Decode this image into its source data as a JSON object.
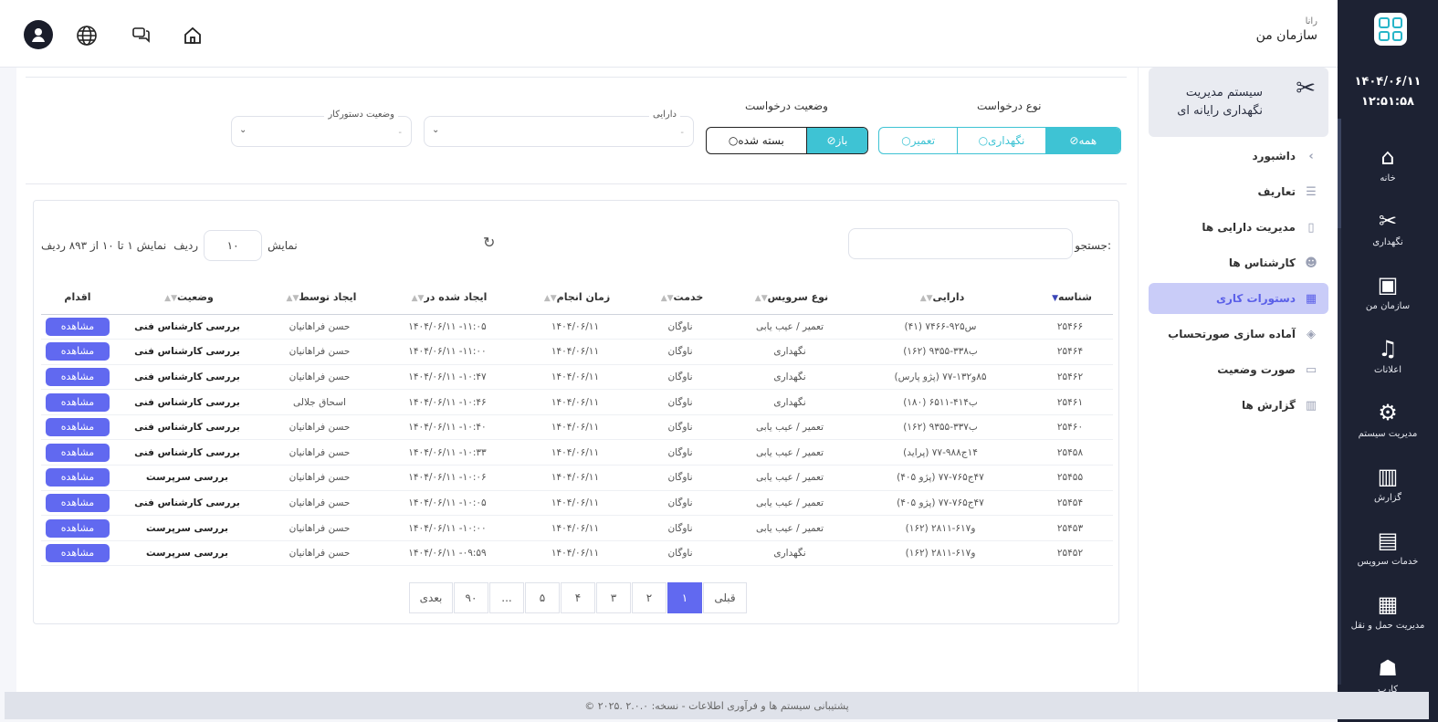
{
  "rail": {
    "date": "۱۴۰۴/۰۶/۱۱",
    "time": "۱۲:۵۱:۵۸",
    "items": [
      {
        "label": "خانه",
        "icon": "home-icon"
      },
      {
        "label": "نگهداری",
        "icon": "tools-icon"
      },
      {
        "label": "سازمان من",
        "icon": "organization-icon"
      },
      {
        "label": "اعلانات",
        "icon": "bell-icon"
      },
      {
        "label": "مدیریت سیستم",
        "icon": "gears-icon"
      },
      {
        "label": "گزارش",
        "icon": "report-chart-icon"
      },
      {
        "label": "خدمات سرویس",
        "icon": "bus-icon"
      },
      {
        "label": "مدیریت حمل و نقل",
        "icon": "car-icon"
      },
      {
        "label": "کارب",
        "icon": "users-icon"
      }
    ]
  },
  "header": {
    "org_small": "رانا",
    "org_name": "سازمان من"
  },
  "sidebar": {
    "system_title": "سیستم مدیریت نگهداری رایانه ای",
    "items": [
      {
        "label": "داشبورد",
        "icon": "chevron-left-icon"
      },
      {
        "label": "تعاریف",
        "icon": "definitions-icon"
      },
      {
        "label": "مدیریت دارایی ها",
        "icon": "asset-icon"
      },
      {
        "label": "کارشناس ها",
        "icon": "experts-icon"
      },
      {
        "label": "دستورات کاری",
        "icon": "work-orders-icon"
      },
      {
        "label": "آماده سازی صورتحساب",
        "icon": "layers-icon"
      },
      {
        "label": "صورت وضعیت",
        "icon": "briefcase-icon"
      },
      {
        "label": "گزارش ها",
        "icon": "bar-chart-icon"
      }
    ]
  },
  "filters": {
    "request_type_label": "نوع درخواست",
    "request_type_options": [
      "همه",
      "نگهداری",
      "تعمیر"
    ],
    "request_status_label": "وضعیت درخواست",
    "request_status_options": [
      "باز",
      "بسته شده"
    ],
    "asset_label": "دارایی",
    "asset_value": "-",
    "contractor_status_label": "وضعیت دستورکار",
    "contractor_status_value": "-"
  },
  "table": {
    "search_label": "جستجو:",
    "show_label": "نمایش",
    "rows_label": "ردیف",
    "page_size": "۱۰",
    "info": "نمایش ۱ تا ۱۰ از ۸۹۳ ردیف",
    "columns": [
      "شناسه",
      "دارایی",
      "نوع سرویس",
      "خدمت",
      "زمان انجام",
      "ایجاد شده در",
      "ایجاد توسط",
      "وضعیت",
      "اقدام"
    ],
    "view_label": "مشاهده",
    "rows": [
      [
        "۲۵۴۶۶",
        "(۴۱) ۷۴س۹۲۵-۶۶",
        "تعمیر / عیب یابی",
        "ناوگان",
        "۱۴۰۴/۰۶/۱۱",
        "۱۴۰۴/۰۶/۱۱ -۱۱:۰۵",
        "حسن فراهانیان",
        "بررسی کارشناس فنی"
      ],
      [
        "۲۵۴۶۴",
        "(۱۶۲) ۹۳ب۳۳۸-۵۵",
        "نگهداری",
        "ناوگان",
        "۱۴۰۴/۰۶/۱۱",
        "۱۴۰۴/۰۶/۱۱ -۱۱:۰۰",
        "حسن فراهانیان",
        "بررسی کارشناس فنی"
      ],
      [
        "۲۵۴۶۲",
        "(پژو پارس) ۸۵و۱۳۲-۷۷",
        "نگهداری",
        "ناوگان",
        "۱۴۰۴/۰۶/۱۱",
        "۱۴۰۴/۰۶/۱۱ -۱۰:۴۷",
        "حسن فراهانیان",
        "بررسی کارشناس فنی"
      ],
      [
        "۲۵۴۶۱",
        "(۱۸۰) ۶۵ب۴۱۴-۱۱",
        "نگهداری",
        "ناوگان",
        "۱۴۰۴/۰۶/۱۱",
        "۱۴۰۴/۰۶/۱۱ -۱۰:۴۶",
        "اسحاق جلالی",
        "بررسی کارشناس فنی"
      ],
      [
        "۲۵۴۶۰",
        "(۱۶۲) ۹۳ب۳۳۷-۵۵",
        "تعمیر / عیب یابی",
        "ناوگان",
        "۱۴۰۴/۰۶/۱۱",
        "۱۴۰۴/۰۶/۱۱ -۱۰:۴۰",
        "حسن فراهانیان",
        "بررسی کارشناس فنی"
      ],
      [
        "۲۵۴۵۸",
        "(پراید) ۱۴ج۹۸۸-۷۷",
        "تعمیر / عیب یابی",
        "ناوگان",
        "۱۴۰۴/۰۶/۱۱",
        "۱۴۰۴/۰۶/۱۱ -۱۰:۳۳",
        "حسن فراهانیان",
        "بررسی کارشناس فنی"
      ],
      [
        "۲۵۴۵۵",
        "(پژو ۴۰۵) ۴۷ج۷۶۵-۷۷",
        "تعمیر / عیب یابی",
        "ناوگان",
        "۱۴۰۴/۰۶/۱۱",
        "۱۴۰۴/۰۶/۱۱ -۱۰:۰۶",
        "حسن فراهانیان",
        "بررسی سرپرست"
      ],
      [
        "۲۵۴۵۴",
        "(پژو ۴۰۵) ۴۷ج۷۶۵-۷۷",
        "تعمیر / عیب یابی",
        "ناوگان",
        "۱۴۰۴/۰۶/۱۱",
        "۱۴۰۴/۰۶/۱۱ -۱۰:۰۵",
        "حسن فراهانیان",
        "بررسی کارشناس فنی"
      ],
      [
        "۲۵۴۵۳",
        "(۱۶۲) ۲۸و۶۱۷-۱۱",
        "تعمیر / عیب یابی",
        "ناوگان",
        "۱۴۰۴/۰۶/۱۱",
        "۱۴۰۴/۰۶/۱۱ -۱۰:۰۰",
        "حسن فراهانیان",
        "بررسی سرپرست"
      ],
      [
        "۲۵۴۵۲",
        "(۱۶۲) ۲۸و۶۱۷-۱۱",
        "نگهداری",
        "ناوگان",
        "۱۴۰۴/۰۶/۱۱",
        "۱۴۰۴/۰۶/۱۱ -۰۹:۵۹",
        "حسن فراهانیان",
        "بررسی سرپرست"
      ]
    ]
  },
  "pager": {
    "prev": "قبلی",
    "next": "بعدی",
    "pages": [
      "۱",
      "۲",
      "۳",
      "۴",
      "۵",
      "...",
      "۹۰"
    ],
    "current": "۱"
  },
  "footer": {
    "text": "© ۲۰۲۵. پشتیبانی سیستم ها و فرآوری اطلاعات - نسخه: ۲.۰.۰"
  },
  "colors": {
    "accent": "#3ec3d4",
    "primary": "#6169f0",
    "rail": "#1d2233"
  }
}
